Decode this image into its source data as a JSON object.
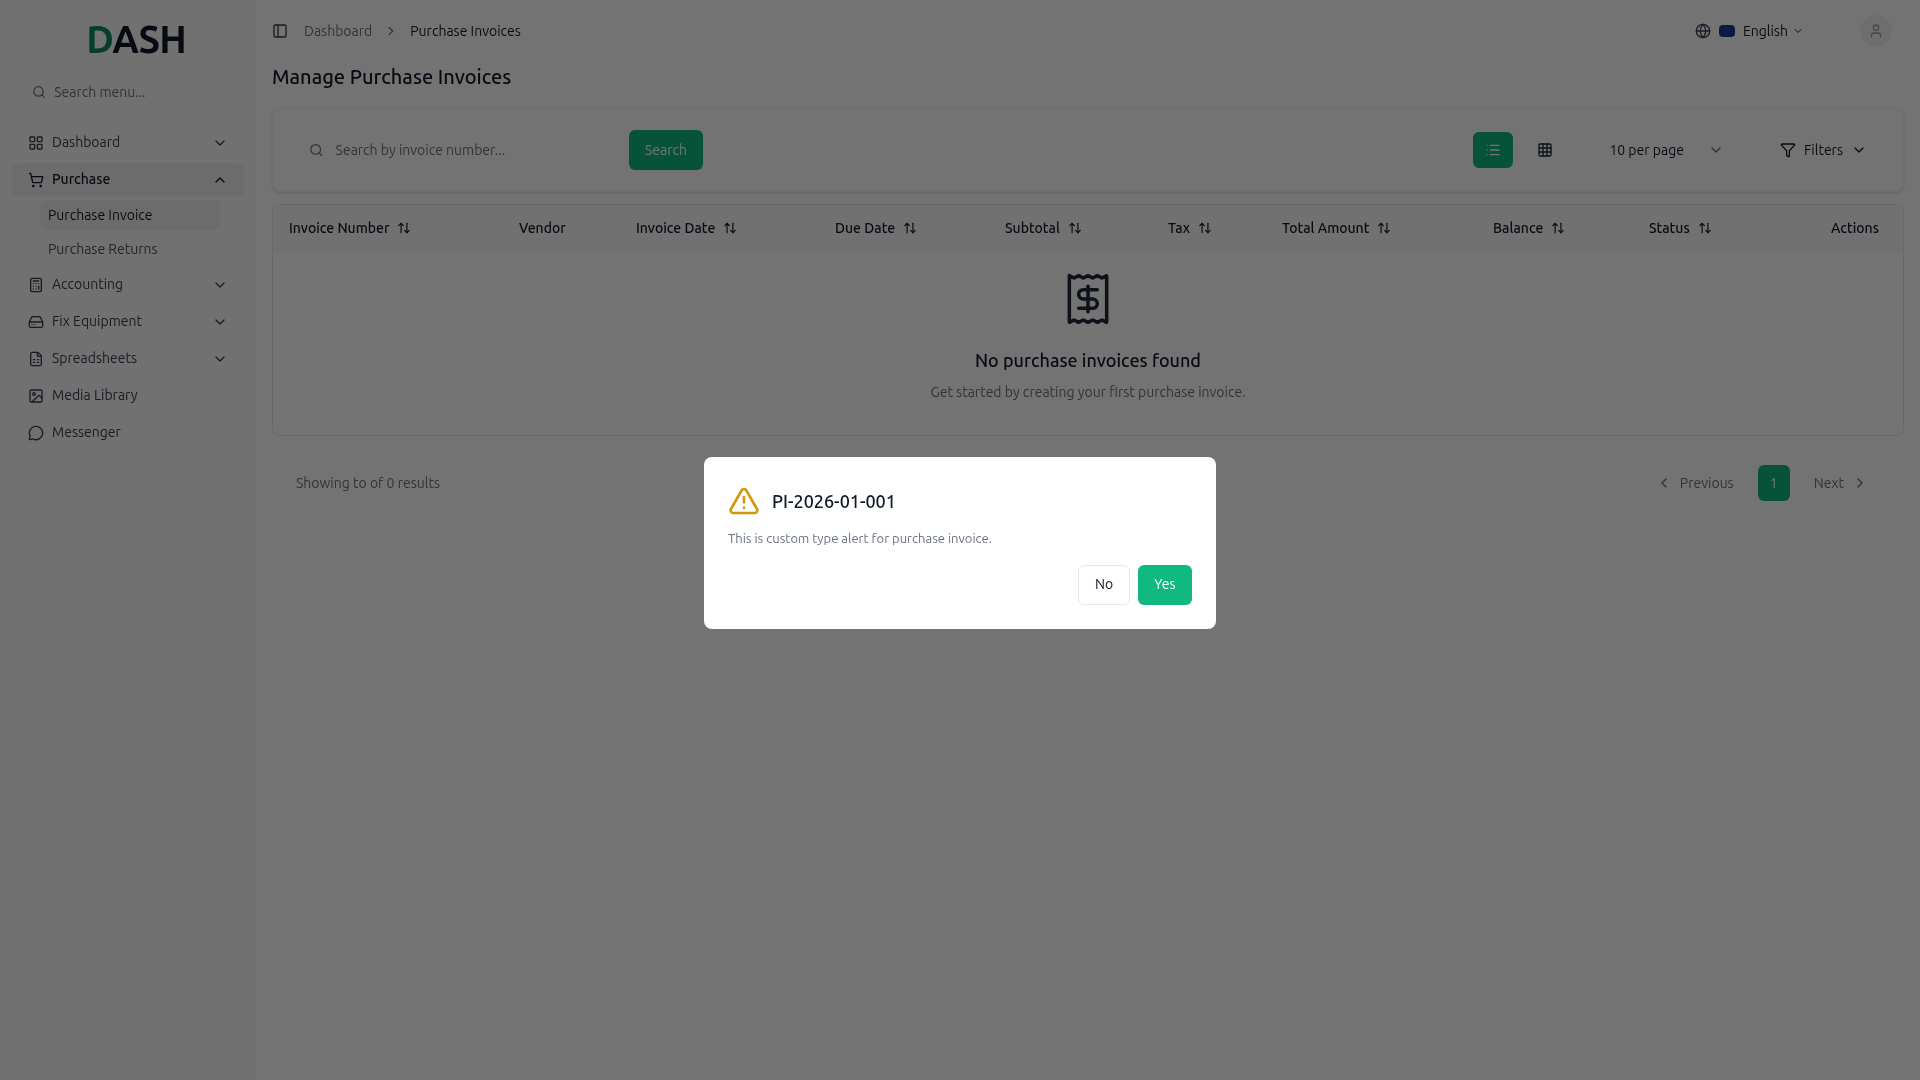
{
  "sidebar": {
    "logo": {
      "accent": "D",
      "rest": "ASH"
    },
    "search": {
      "placeholder": "Search menu..."
    },
    "items": [
      {
        "label": "Dashboard",
        "expandable": true,
        "expanded": false,
        "selected": false
      },
      {
        "label": "Purchase",
        "expandable": true,
        "expanded": true,
        "selected": true,
        "children": [
          {
            "label": "Purchase Invoice",
            "selected": true
          },
          {
            "label": "Purchase Returns",
            "selected": false
          }
        ]
      },
      {
        "label": "Accounting",
        "expandable": true,
        "expanded": false,
        "selected": false
      },
      {
        "label": "Fix Equipment",
        "expandable": true,
        "expanded": false,
        "selected": false
      },
      {
        "label": "Spreadsheets",
        "expandable": true,
        "expanded": false,
        "selected": false
      },
      {
        "label": "Media Library",
        "expandable": false,
        "selected": false
      },
      {
        "label": "Messenger",
        "expandable": false,
        "selected": false
      }
    ]
  },
  "header": {
    "breadcrumb": [
      "Dashboard",
      "Purchase Invoices"
    ],
    "language": "English"
  },
  "page_title": "Manage Purchase Invoices",
  "toolbar": {
    "search": {
      "placeholder": "Search by invoice number..."
    },
    "search_button": "Search",
    "views": [
      {
        "kind": "list",
        "selected": true
      },
      {
        "kind": "grid",
        "selected": false
      }
    ],
    "per_page": "10 per page",
    "filters": "Filters"
  },
  "table": {
    "columns": [
      {
        "label": "Invoice Number",
        "sortable": true
      },
      {
        "label": "Vendor",
        "sortable": false
      },
      {
        "label": "Invoice Date",
        "sortable": true
      },
      {
        "label": "Due Date",
        "sortable": true
      },
      {
        "label": "Subtotal",
        "sortable": true
      },
      {
        "label": "Tax",
        "sortable": true
      },
      {
        "label": "Total Amount",
        "sortable": true
      },
      {
        "label": "Balance",
        "sortable": true
      },
      {
        "label": "Status",
        "sortable": true
      },
      {
        "label": "Actions",
        "sortable": false
      }
    ],
    "empty": {
      "title": "No purchase invoices found",
      "subtitle": "Get started by creating your first purchase invoice."
    }
  },
  "pagination": {
    "summary": "Showing to of 0 results",
    "previous": "Previous",
    "pages": [
      {
        "label": "1",
        "selected": true
      }
    ],
    "next": "Next"
  },
  "dialog": {
    "title": "PI-2026-01-001",
    "message": "This is custom type alert for purchase invoice.",
    "buttons": [
      {
        "label": "No",
        "kind": "secondary"
      },
      {
        "label": "Yes",
        "kind": "primary"
      }
    ]
  }
}
